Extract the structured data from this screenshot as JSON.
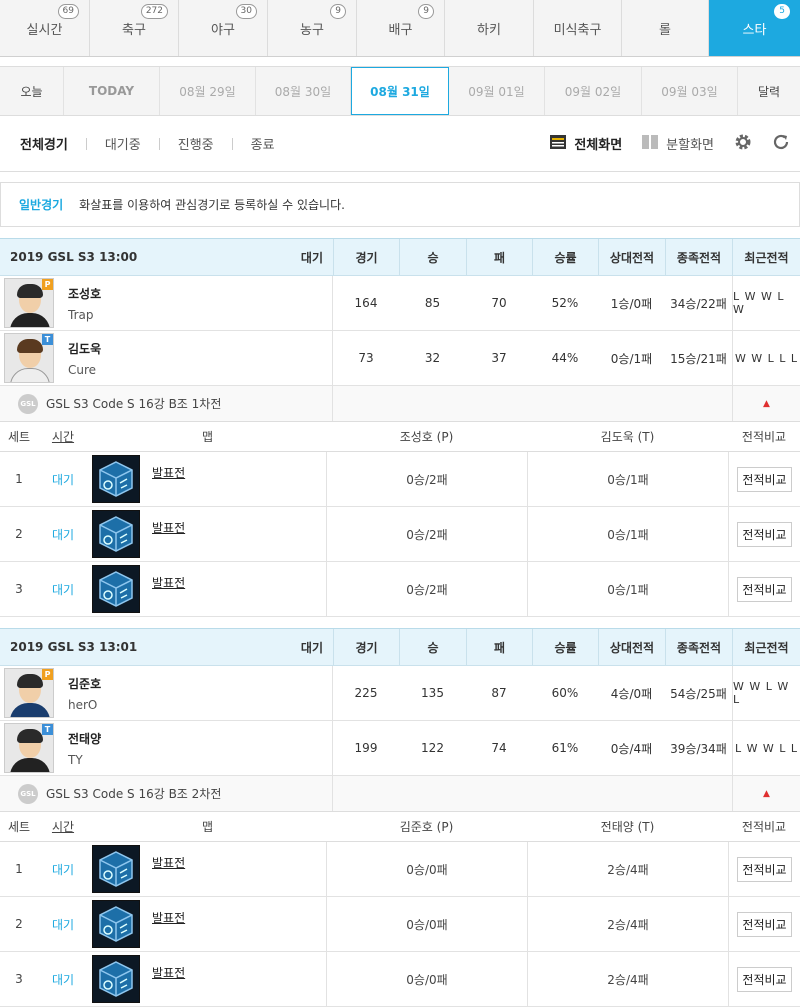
{
  "sports": [
    {
      "label": "실시간",
      "count": "69"
    },
    {
      "label": "축구",
      "count": "272"
    },
    {
      "label": "야구",
      "count": "30"
    },
    {
      "label": "농구",
      "count": "9"
    },
    {
      "label": "배구",
      "count": "9"
    },
    {
      "label": "하키",
      "count": ""
    },
    {
      "label": "미식축구",
      "count": ""
    },
    {
      "label": "롤",
      "count": ""
    },
    {
      "label": "스타",
      "count": "5"
    }
  ],
  "dates": [
    "오늘",
    "TODAY",
    "08월 29일",
    "08월 30일",
    "08월 31일",
    "09월 01일",
    "09월 02일",
    "09월 03일",
    "달력"
  ],
  "filters": {
    "all": "전체경기",
    "waiting": "대기중",
    "live": "진행중",
    "ended": "종료",
    "fullscreen": "전체화면",
    "split": "분할화면"
  },
  "notice": {
    "label": "일반경기",
    "text": "화살표를 이용하여 관심경기로 등록하실 수 있습니다."
  },
  "colheads": [
    "경기",
    "승",
    "패",
    "승률",
    "상대전적",
    "종족전적",
    "최근전적"
  ],
  "sethead": {
    "set": "세트",
    "time": "시간",
    "map": "맵",
    "compare": "전적비교"
  },
  "matches": [
    {
      "title": "2019 GSL S3  13:00",
      "status": "대기",
      "players": [
        {
          "kname": "조성호",
          "ename": "Trap",
          "race": "P",
          "games": "164",
          "win": "85",
          "loss": "70",
          "rate": "52%",
          "h2h": "1승/0패",
          "racewin": "34승/22패",
          "recent": "L W W L W"
        },
        {
          "kname": "김도욱",
          "ename": "Cure",
          "race": "T",
          "games": "73",
          "win": "32",
          "loss": "37",
          "rate": "44%",
          "h2h": "0승/1패",
          "racewin": "15승/21패",
          "recent": "W W L L L"
        }
      ],
      "league": "GSL S3 Code S 16강 B조 1차전",
      "p1col": "조성호 (P)",
      "p2col": "김도욱 (T)",
      "sets": [
        {
          "no": "1",
          "time": "대기",
          "map": "발표전",
          "p1": "0승/2패",
          "p2": "0승/1패",
          "btn": "전적비교"
        },
        {
          "no": "2",
          "time": "대기",
          "map": "발표전",
          "p1": "0승/2패",
          "p2": "0승/1패",
          "btn": "전적비교"
        },
        {
          "no": "3",
          "time": "대기",
          "map": "발표전",
          "p1": "0승/2패",
          "p2": "0승/1패",
          "btn": "전적비교"
        }
      ]
    },
    {
      "title": "2019 GSL S3  13:01",
      "status": "대기",
      "players": [
        {
          "kname": "김준호",
          "ename": "herO",
          "race": "P",
          "games": "225",
          "win": "135",
          "loss": "87",
          "rate": "60%",
          "h2h": "4승/0패",
          "racewin": "54승/25패",
          "recent": "W W L W L"
        },
        {
          "kname": "전태양",
          "ename": "TY",
          "race": "T",
          "games": "199",
          "win": "122",
          "loss": "74",
          "rate": "61%",
          "h2h": "0승/4패",
          "racewin": "39승/34패",
          "recent": "L W W L L"
        }
      ],
      "league": "GSL S3 Code S 16강 B조 2차전",
      "p1col": "김준호 (P)",
      "p2col": "전태양 (T)",
      "sets": [
        {
          "no": "1",
          "time": "대기",
          "map": "발표전",
          "p1": "0승/0패",
          "p2": "2승/4패",
          "btn": "전적비교"
        },
        {
          "no": "2",
          "time": "대기",
          "map": "발표전",
          "p1": "0승/0패",
          "p2": "2승/4패",
          "btn": "전적비교"
        },
        {
          "no": "3",
          "time": "대기",
          "map": "발표전",
          "p1": "0승/0패",
          "p2": "2승/4패",
          "btn": "전적비교"
        }
      ]
    }
  ]
}
